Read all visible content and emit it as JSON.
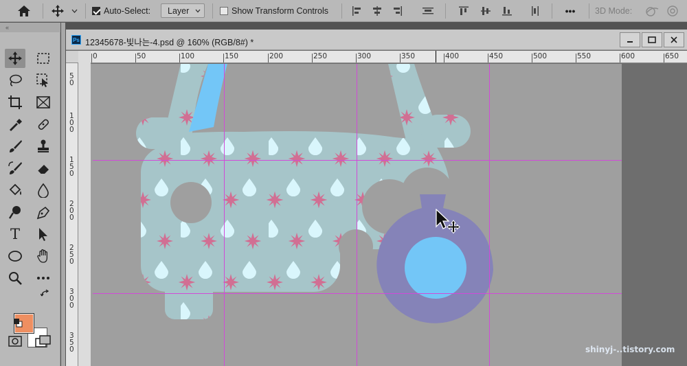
{
  "options_bar": {
    "auto_select_label": "Auto-Select:",
    "auto_select_checked": true,
    "layer_select_value": "Layer",
    "show_transform_label": "Show Transform Controls",
    "show_transform_checked": false,
    "more_label": "•••",
    "mode_3d_label": "3D Mode:"
  },
  "document": {
    "ps_badge": "Ps",
    "title": "12345678-빛나는-4.psd @ 160% (RGB/8#) *",
    "zoom": "160%",
    "color_mode": "RGB/8#"
  },
  "ruler": {
    "top_labels": [
      "0",
      "50",
      "100",
      "150",
      "200",
      "250",
      "300",
      "350",
      "400",
      "450",
      "500",
      "550",
      "600",
      "650"
    ],
    "left_labels": [
      [
        "5",
        "0"
      ],
      [
        "1",
        "0",
        "0"
      ],
      [
        "1",
        "5",
        "0"
      ],
      [
        "2",
        "0",
        "0"
      ],
      [
        "2",
        "5",
        "0"
      ],
      [
        "3",
        "0",
        "0"
      ],
      [
        "3",
        "5",
        "0"
      ]
    ]
  },
  "tools": [
    "move-tool",
    "marquee-tool",
    "lasso-tool",
    "object-select-tool",
    "crop-tool",
    "frame-tool",
    "eyedropper-tool",
    "healing-tool",
    "brush-tool",
    "stamp-tool",
    "history-brush-tool",
    "eraser-tool",
    "paint-bucket-tool",
    "blur-tool",
    "dodge-tool",
    "pen-tool",
    "type-tool",
    "path-select-tool",
    "ellipse-tool",
    "hand-tool",
    "zoom-tool",
    "more-tools"
  ],
  "type_tool_label": "T",
  "colors": {
    "foreground": "#ef8f61",
    "background": "#ffffff",
    "canvas_bg": "#73c6f7",
    "car_fill": "#a6c5c9",
    "drop_fill": "#d9f6fc",
    "star_fill": "#d16f93",
    "ring_fill": "#8583b8",
    "guide": "#d14ad8"
  },
  "watermark": "shinyj-..tistory.com"
}
